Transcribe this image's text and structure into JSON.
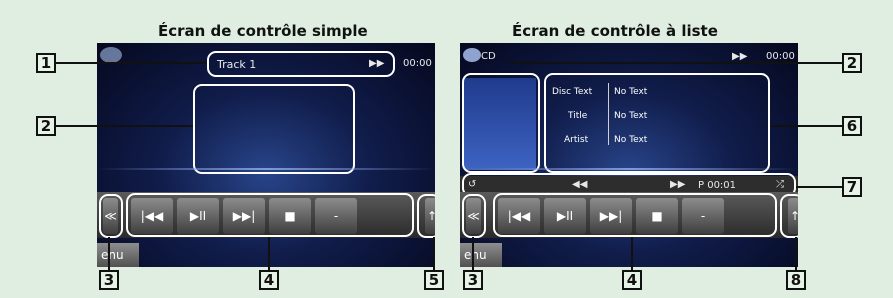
{
  "headings": {
    "simple": "Écran de contrôle simple",
    "list": "Écran de contrôle à liste"
  },
  "simple": {
    "track": "Track 1",
    "ff": "▶▶",
    "time": "00:00",
    "menu": "enu",
    "buttons": [
      "|◀◀",
      "▶II",
      "▶▶|",
      "■",
      "-"
    ],
    "side_left": "≪",
    "side_right": "↑"
  },
  "list": {
    "source": "CD",
    "ff": "▶▶",
    "time": "00:00",
    "menu": "enu",
    "labels": [
      "Disc Text",
      "Title",
      "Artist"
    ],
    "values": [
      "No Text",
      "No Text",
      "No Text"
    ],
    "controls": {
      "repeat": "↺",
      "rewind": "◀◀",
      "forward": "▶▶",
      "playtime": "P 00:01",
      "shuffle": "⤮"
    },
    "buttons": [
      "|◀◀",
      "▶II",
      "▶▶|",
      "■",
      "-"
    ],
    "side_left": "≪",
    "side_right": "↑"
  },
  "numbers": {
    "n1": "1",
    "n2a": "2",
    "n2b": "2",
    "n3a": "3",
    "n3b": "3",
    "n4a": "4",
    "n4b": "4",
    "n5": "5",
    "n6": "6",
    "n7": "7",
    "n8": "8"
  },
  "colors": {
    "callout": "#ffffff",
    "background": "#dfeee0",
    "screen": "#101c4a"
  }
}
